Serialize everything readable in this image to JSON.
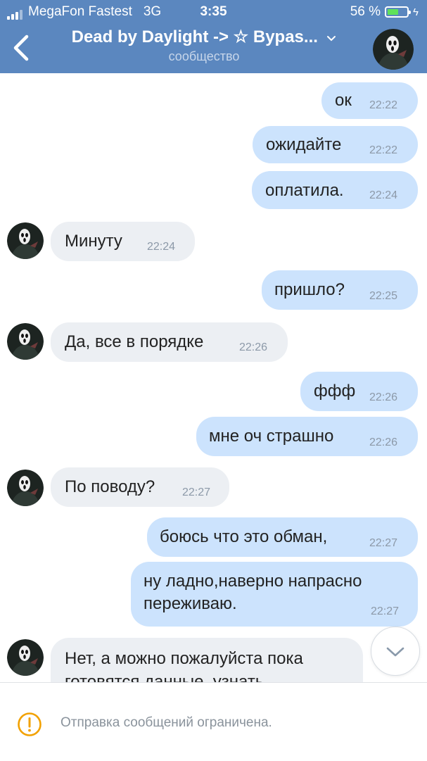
{
  "status_bar": {
    "carrier": "MegaFon Fastest",
    "network": "3G",
    "time": "3:35",
    "battery_percent": "56 %",
    "battery_level": 0.56
  },
  "header": {
    "title": "Dead by Daylight -> ☆ Bypas...",
    "subtitle": "сообщество",
    "avatar_icon": "ghostface-avatar"
  },
  "messages": [
    {
      "dir": "out",
      "text": "ок",
      "time": "22:22"
    },
    {
      "dir": "out",
      "text": "ожидайте",
      "time": "22:22"
    },
    {
      "dir": "out",
      "text": "оплатила.",
      "time": "22:24"
    },
    {
      "dir": "in",
      "text": "Минуту",
      "time": "22:24"
    },
    {
      "dir": "out",
      "text": "пришло?",
      "time": "22:25"
    },
    {
      "dir": "in",
      "text": "Да, все в порядке",
      "time": "22:26"
    },
    {
      "dir": "out",
      "text": "ффф",
      "time": "22:26"
    },
    {
      "dir": "out",
      "text": "мне оч страшно",
      "time": "22:26"
    },
    {
      "dir": "in",
      "text": "По поводу?",
      "time": "22:27"
    },
    {
      "dir": "out",
      "text": "боюсь что это обман,",
      "time": "22:27"
    },
    {
      "dir": "out",
      "lines": [
        "ну ладно,наверно напрасно",
        "переживаю."
      ],
      "time": "22:27"
    },
    {
      "dir": "in",
      "lines": [
        "Нет, а можно пожалуйста пока",
        "готовятся данные, узнать"
      ],
      "time": ""
    }
  ],
  "footer": {
    "warning_icon": "exclamation-circle-icon",
    "text": "Отправка сообщений ограничена."
  },
  "colors": {
    "header": "#5b87bf",
    "outgoing_bubble": "#cce3fd",
    "incoming_bubble": "#eceff3",
    "warning": "#f2a100",
    "battery": "#5fe15a"
  }
}
